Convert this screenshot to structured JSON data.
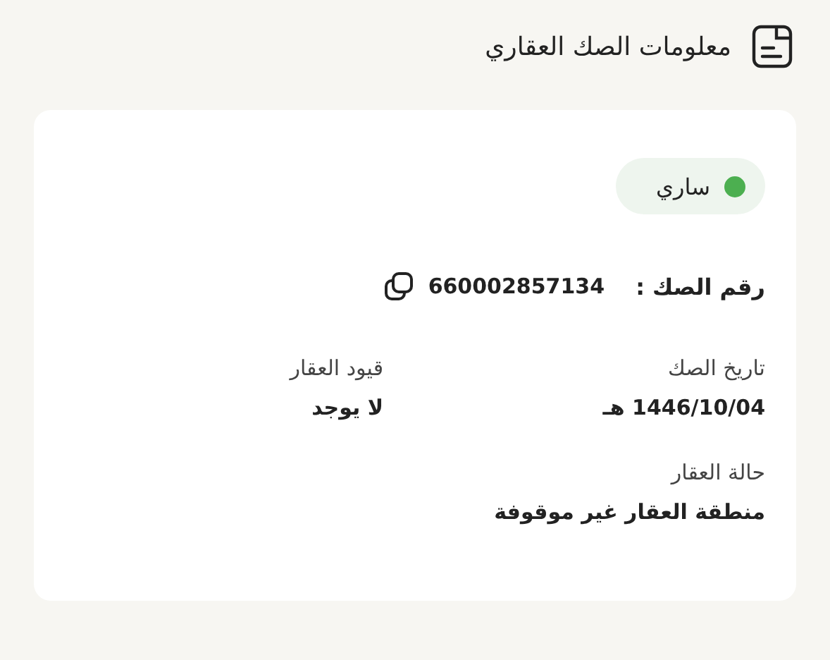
{
  "header": {
    "title": "معلومات الصك العقاري"
  },
  "status": {
    "label": "ساري",
    "color": "#4caf50"
  },
  "deed_number": {
    "label": "رقم الصك :",
    "value": "660002857134"
  },
  "fields": [
    {
      "label": "تاريخ الصك",
      "value": "1446/10/04 هـ"
    },
    {
      "label": "قيود العقار",
      "value": "لا يوجد"
    },
    {
      "label": "حالة العقار",
      "value": "منطقة العقار غير موقوفة"
    }
  ]
}
